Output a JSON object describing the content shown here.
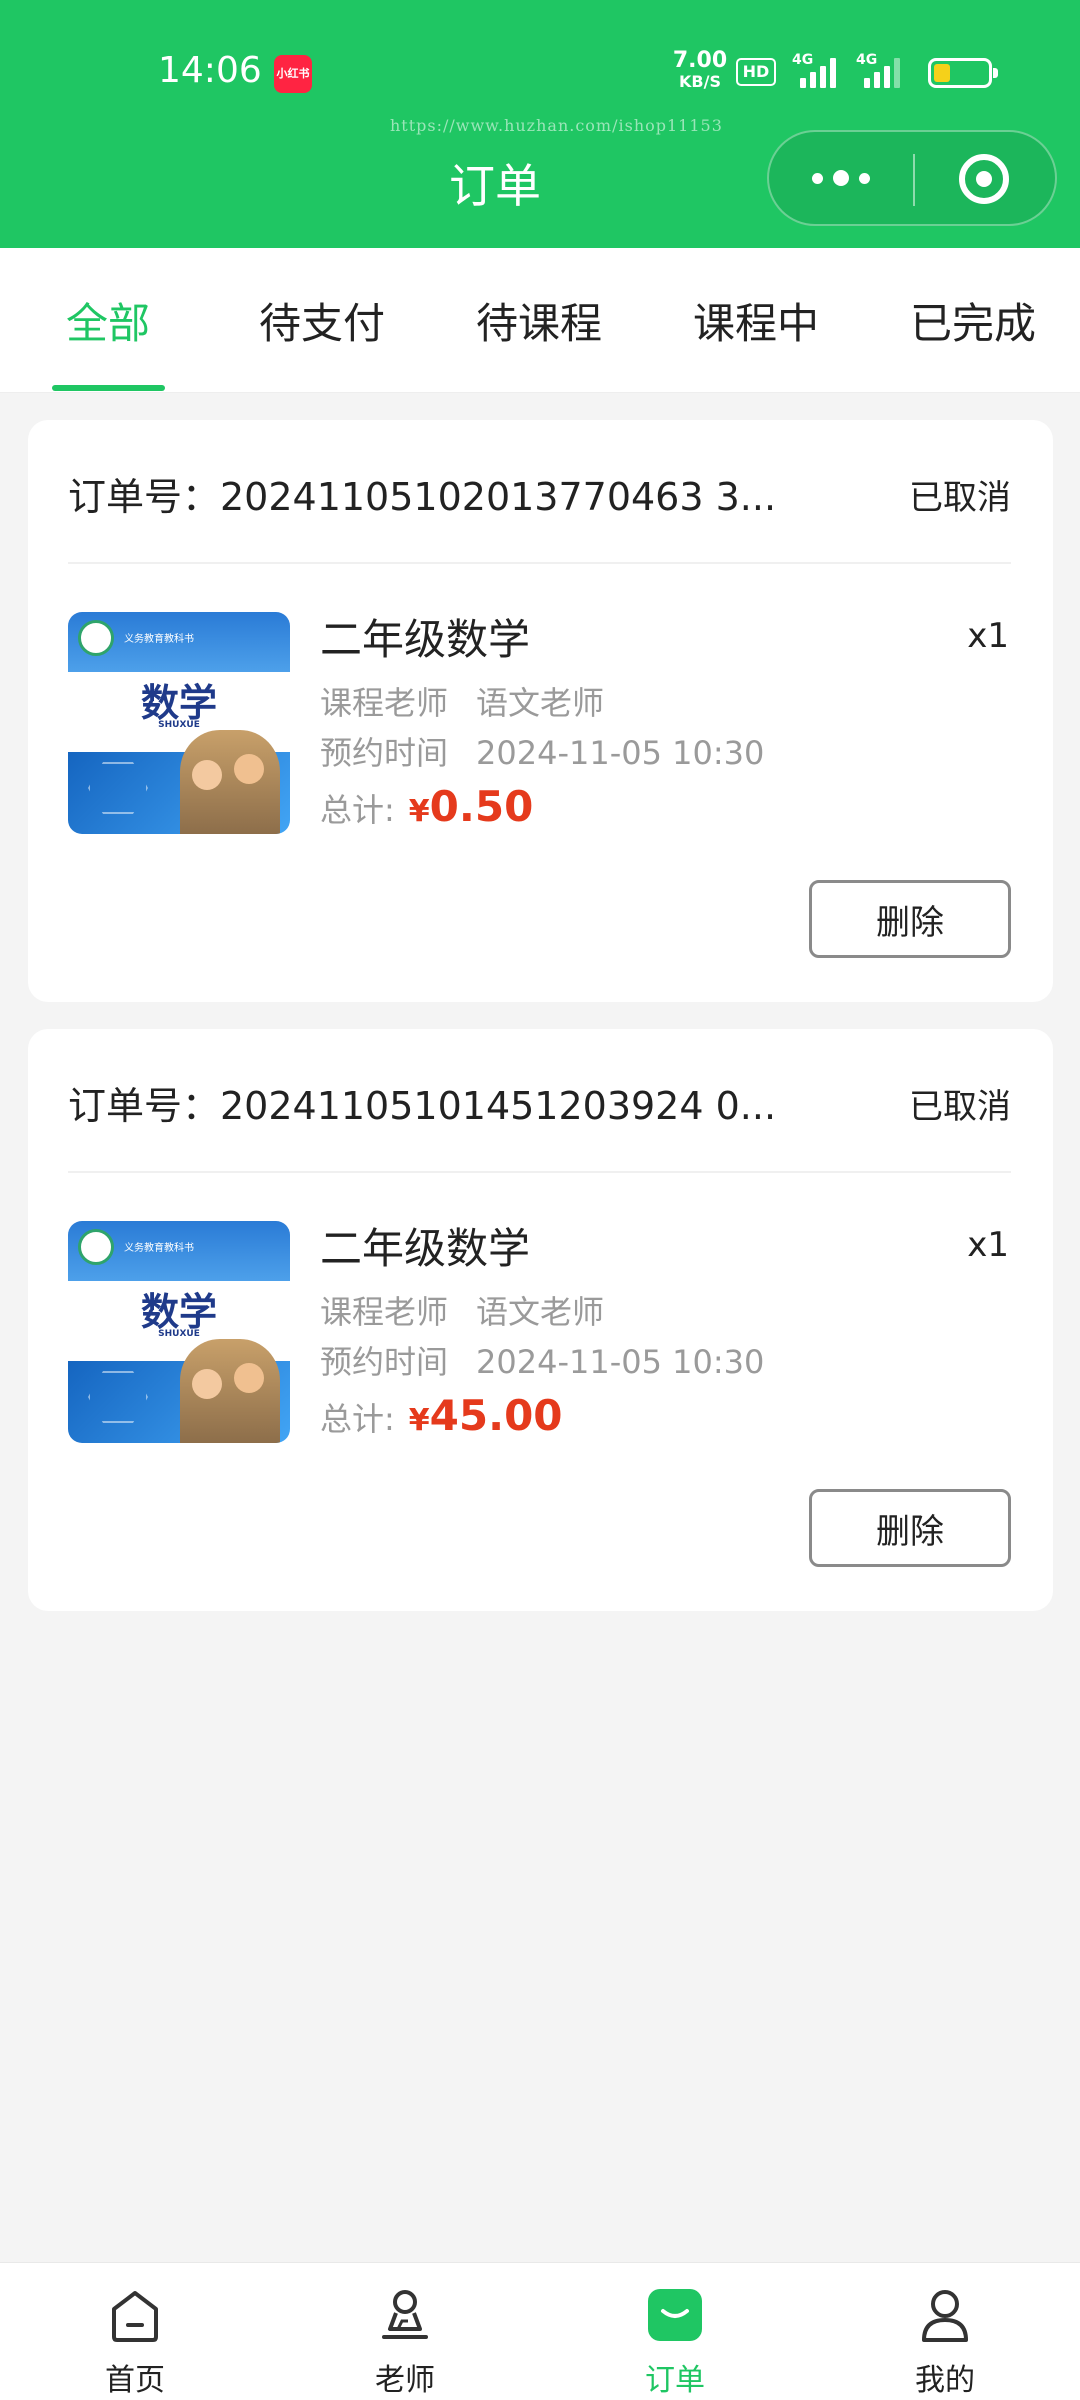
{
  "status_bar": {
    "time": "14:06",
    "app_badge": "小红书",
    "net_speed_value": "7.00",
    "net_speed_unit": "KB/S",
    "hd_label": "HD",
    "sim1_label": "4G",
    "sim2_label": "4G",
    "battery_level": 0.3
  },
  "watermark": "https://www.huzhan.com/ishop11153",
  "header": {
    "title": "订单"
  },
  "tabs": [
    {
      "label": "全部",
      "active": true
    },
    {
      "label": "待支付",
      "active": false
    },
    {
      "label": "待课程",
      "active": false
    },
    {
      "label": "课程中",
      "active": false
    },
    {
      "label": "已完成",
      "active": false
    }
  ],
  "orders": [
    {
      "order_no": "订单号：20241105102013770463 3...",
      "status": "已取消",
      "cover": {
        "math_title": "数学",
        "pinyin": "SHUXUE",
        "small_title": "义务教育教科书"
      },
      "course_name": "二年级数学",
      "quantity": "x1",
      "teacher_label": "课程老师",
      "teacher_value": "语文老师",
      "time_label": "预约时间",
      "time_value": "2024-11-05 10:30",
      "total_label": "总计:",
      "currency": "¥",
      "amount": "0.50",
      "delete_label": "删除"
    },
    {
      "order_no": "订单号：20241105101451203924 0...",
      "status": "已取消",
      "cover": {
        "math_title": "数学",
        "pinyin": "SHUXUE",
        "small_title": "义务教育教科书"
      },
      "course_name": "二年级数学",
      "quantity": "x1",
      "teacher_label": "课程老师",
      "teacher_value": "语文老师",
      "time_label": "预约时间",
      "time_value": "2024-11-05 10:30",
      "total_label": "总计:",
      "currency": "¥",
      "amount": "45.00",
      "delete_label": "删除"
    }
  ],
  "bottom_nav": [
    {
      "label": "首页",
      "icon": "home-icon",
      "active": false
    },
    {
      "label": "老师",
      "icon": "teacher-icon",
      "active": false
    },
    {
      "label": "订单",
      "icon": "orders-icon",
      "active": true
    },
    {
      "label": "我的",
      "icon": "profile-icon",
      "active": false
    }
  ],
  "colors": {
    "brand_green": "#1fc663",
    "price_red": "#e53a1c"
  }
}
